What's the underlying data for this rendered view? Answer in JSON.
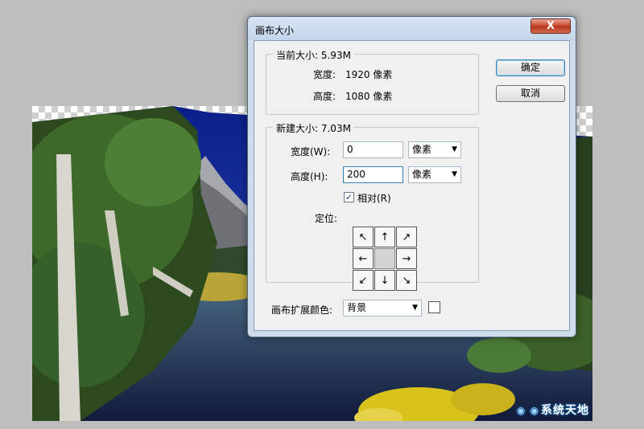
{
  "dialog": {
    "title": "画布大小",
    "close_label": "X",
    "current_size": {
      "group_label": "当前大小: 5.93M",
      "width_label": "宽度:",
      "width_value": "1920 像素",
      "height_label": "高度:",
      "height_value": "1080 像素"
    },
    "new_size": {
      "group_label": "新建大小: 7.03M",
      "width_label": "宽度(W):",
      "width_value": "0",
      "width_unit": "像素",
      "height_label": "高度(H):",
      "height_value": "200",
      "height_unit": "像素",
      "relative_label": "相对(R)",
      "relative_checked": true,
      "anchor_label": "定位:",
      "anchor_arrows": [
        "↖",
        "↑",
        "↗",
        "←",
        "",
        "→",
        "↙",
        "↓",
        "↘"
      ]
    },
    "extension_color_label": "画布扩展颜色:",
    "extension_color_value": "背景",
    "extension_swatch_color": "#ffffff",
    "ok_label": "确定",
    "cancel_label": "取消"
  },
  "watermark": {
    "text": "系统天地"
  }
}
